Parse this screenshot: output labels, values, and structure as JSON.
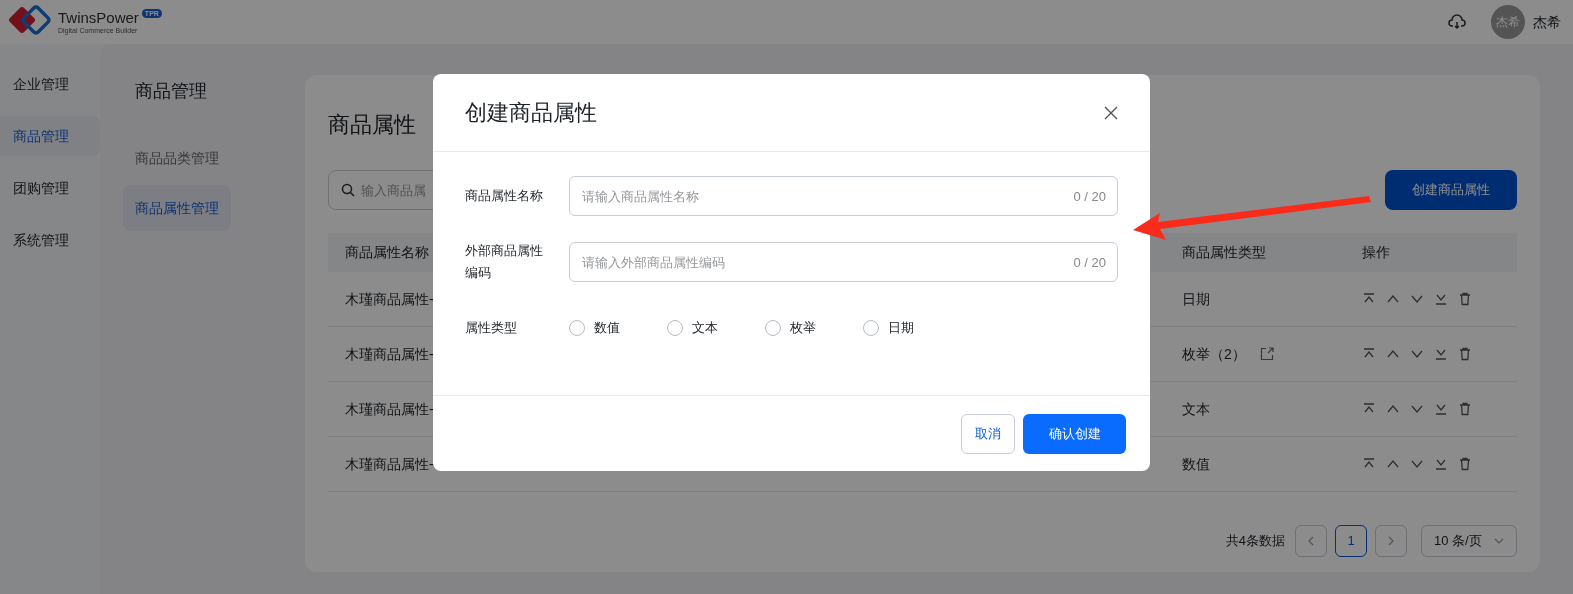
{
  "header": {
    "brand": "TwinsPower",
    "brand_badge": "TPR",
    "brand_tagline": "Digital Commerce Builder",
    "user": {
      "avatar_text": "杰希",
      "name": "杰希"
    }
  },
  "sidebar": {
    "items": [
      {
        "label": "企业管理",
        "selected": false
      },
      {
        "label": "商品管理",
        "selected": true
      },
      {
        "label": "团购管理",
        "selected": false
      },
      {
        "label": "系统管理",
        "selected": false
      }
    ]
  },
  "subnav": {
    "title": "商品管理",
    "items": [
      {
        "label": "商品品类管理",
        "selected": false
      },
      {
        "label": "商品属性管理",
        "selected": true
      }
    ]
  },
  "content": {
    "title": "商品属性",
    "search": {
      "placeholder": "输入商品属"
    },
    "create_button": "创建商品属性",
    "table": {
      "columns": [
        "商品属性名称",
        "商品属性类型",
        "操作"
      ],
      "rows": [
        {
          "name": "木瑾商品属性-",
          "type": "日期",
          "editable": false
        },
        {
          "name": "木瑾商品属性-",
          "type": "枚举（2）",
          "editable": true
        },
        {
          "name": "木瑾商品属性-",
          "type": "文本",
          "editable": false
        },
        {
          "name": "木瑾商品属性-",
          "type": "数值",
          "editable": false
        }
      ]
    },
    "pagination": {
      "total": "共4条数据",
      "pages": [
        {
          "label": "1",
          "selected": true
        }
      ],
      "page_size": "10 条/页"
    }
  },
  "modal": {
    "title": "创建商品属性",
    "fields": [
      {
        "label": "商品属性名称",
        "placeholder": "请输入商品属性名称",
        "counter": "0 / 20"
      },
      {
        "label": "外部商品属性编码",
        "placeholder": "请输入外部商品属性编码",
        "counter": "0 / 20"
      }
    ],
    "radio_group": {
      "label": "属性类型",
      "options": [
        {
          "label": "数值",
          "selected": false
        },
        {
          "label": "文本",
          "selected": false
        },
        {
          "label": "枚举",
          "selected": false
        },
        {
          "label": "日期",
          "selected": false
        }
      ]
    },
    "cancel_button": "取消",
    "confirm_button": "确认创建"
  }
}
